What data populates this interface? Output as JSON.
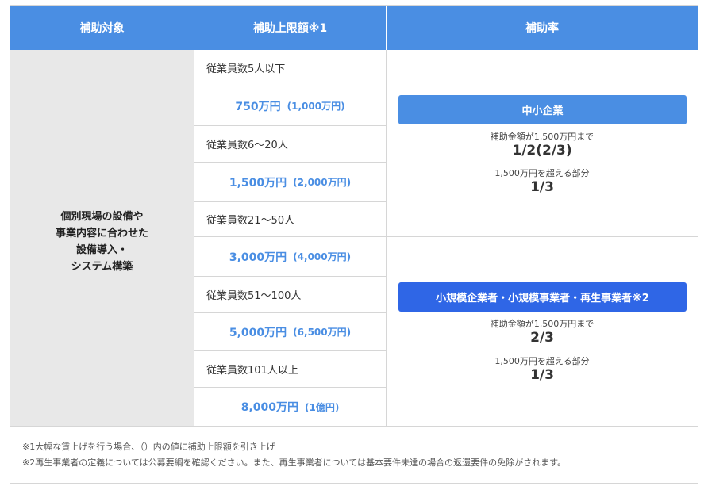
{
  "header": {
    "col1": "補助対象",
    "col2": "補助上限額※1",
    "col3": "補助率"
  },
  "target": {
    "lines": [
      "個別現場の設備や",
      "事業内容に合わせた",
      "設備導入・",
      "システム構築"
    ]
  },
  "tiers": [
    {
      "employees": "従業員数5人以下",
      "amount": "750万円",
      "amount_raised": "(1,000万円)"
    },
    {
      "employees": "従業員数6～20人",
      "amount": "1,500万円",
      "amount_raised": "(2,000万円)"
    },
    {
      "employees": "従業員数21～50人",
      "amount": "3,000万円",
      "amount_raised": "(4,000万円)"
    },
    {
      "employees": "従業員数51～100人",
      "amount": "5,000万円",
      "amount_raised": "(6,500万円)"
    },
    {
      "employees": "従業員数101人以上",
      "amount": "8,000万円",
      "amount_raised": "(1億円)"
    }
  ],
  "rates": [
    {
      "badge": "中小企業",
      "condition1": "補助金額が1,500万円まで",
      "rate1": "1/2(2/3)",
      "condition2": "1,500万円を超える部分",
      "rate2": "1/3"
    },
    {
      "badge": "小規模企業者・小規模事業者・再生事業者※2",
      "condition1": "補助金額が1,500万円まで",
      "rate1": "2/3",
      "condition2": "1,500万円を超える部分",
      "rate2": "1/3"
    }
  ],
  "footnotes": [
    "※1大幅な賃上げを行う場合、（）内の値に補助上限額を引き上げ",
    "※2再生事業者の定義については公募要綱を確認ください。また、再生事業者については基本要件未達の場合の返還要件の免除がされます。"
  ],
  "colors": {
    "header_bg": "#4a8ee3",
    "amount_text": "#4a8ee3",
    "badge_sme": "#4a8ee3",
    "badge_small": "#2f66e6",
    "target_bg": "#e8e8e8"
  }
}
